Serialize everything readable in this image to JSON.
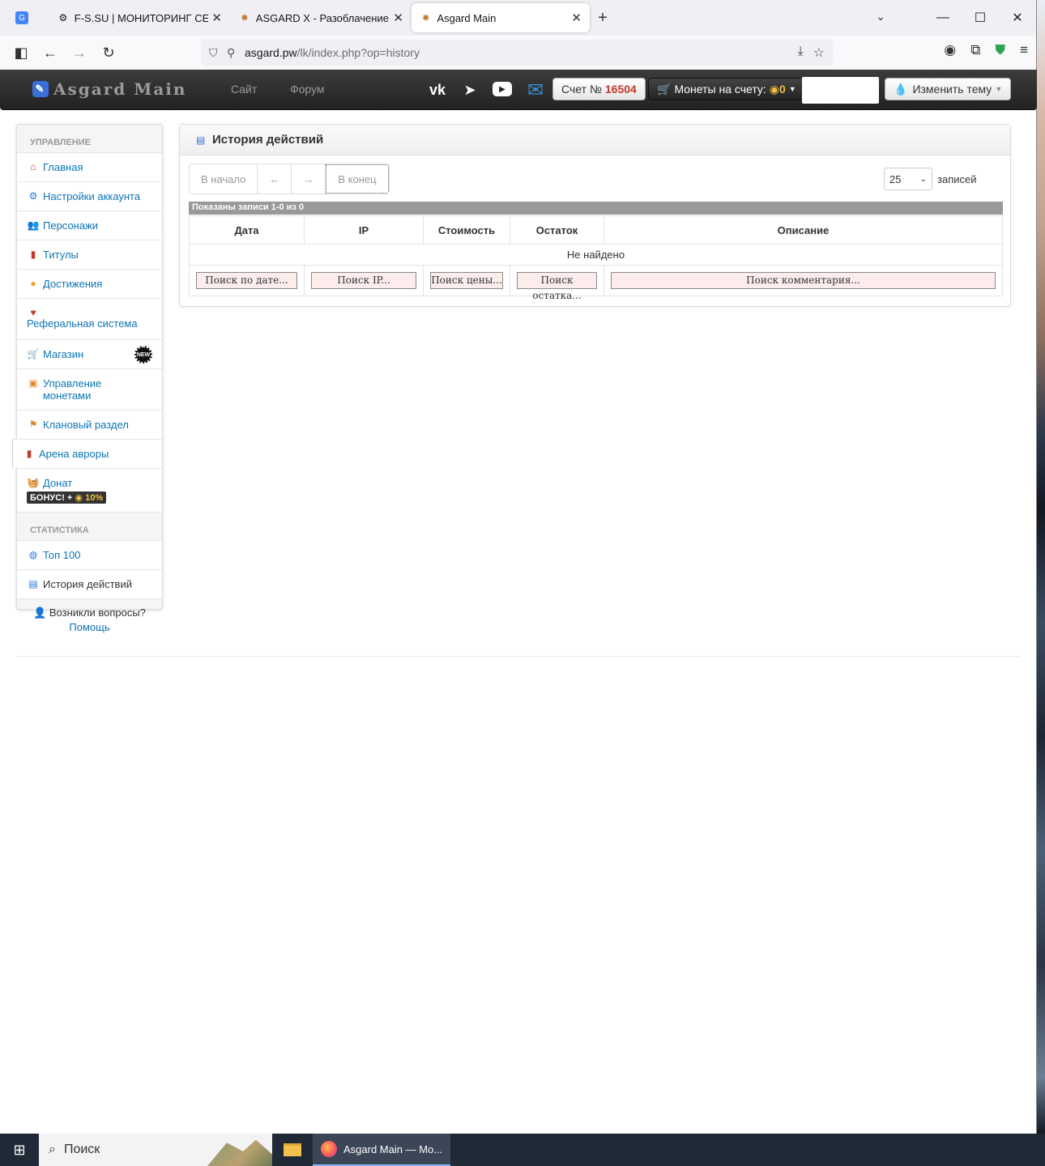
{
  "browser": {
    "tabs": [
      {
        "title": "",
        "icon": "google-translate-icon"
      },
      {
        "title": "F-S.SU | МОНИТОРИНГ СЕРВЕР",
        "icon": "gear-icon"
      },
      {
        "title": "ASGARD X - Разоблачение Бар",
        "icon": "asgard-icon"
      },
      {
        "title": "Asgard Main",
        "icon": "asgard-icon",
        "active": true
      }
    ],
    "url_host": "asgard.pw",
    "url_path": "/lk/index.php?op=history"
  },
  "header": {
    "brand": "Asgard Main",
    "nav": [
      "Сайт",
      "Форум"
    ],
    "account_label": "Счет №",
    "account_number": "16504",
    "coins_label": "Монеты на счету:",
    "coins_value": "0",
    "theme_label": "Изменить тему"
  },
  "sidebar": {
    "section_manage": "Управление",
    "section_stats": "Статистика",
    "items": [
      {
        "label": "Главная"
      },
      {
        "label": "Настройки аккаунта"
      },
      {
        "label": "Персонажи"
      },
      {
        "label": "Титулы"
      },
      {
        "label": "Достижения"
      },
      {
        "label": "Реферальная система"
      },
      {
        "label": "Магазин"
      },
      {
        "label": "Управление монетами"
      },
      {
        "label": "Клановый раздел"
      },
      {
        "label": "Арена авроры"
      },
      {
        "label": "Донат"
      }
    ],
    "shop_badge": "NEW",
    "bonus_label": "БОНУС! +",
    "bonus_pct": "10%",
    "stats_items": [
      {
        "label": "Топ 100"
      },
      {
        "label": "История действий"
      }
    ]
  },
  "help": {
    "question": "Возникли вопросы?",
    "link": "Помощь"
  },
  "main": {
    "title": "История действий",
    "pager": [
      "В начало",
      "←",
      "→",
      "В конец"
    ],
    "per_page_value": "25",
    "per_page_label": "записей",
    "records_info": "Показаны записи 1-0 из 0",
    "columns": [
      "Дата",
      "IP",
      "Стоимость",
      "Остаток",
      "Описание"
    ],
    "not_found": "Не найдено",
    "filters": [
      "Поиск по дате...",
      "Поиск IP...",
      "Поиск цены...",
      "Поиск остатка...",
      "Поиск комментария..."
    ]
  },
  "taskbar": {
    "search_label": "Поиск",
    "active_app": "Asgard Main — Mo..."
  }
}
